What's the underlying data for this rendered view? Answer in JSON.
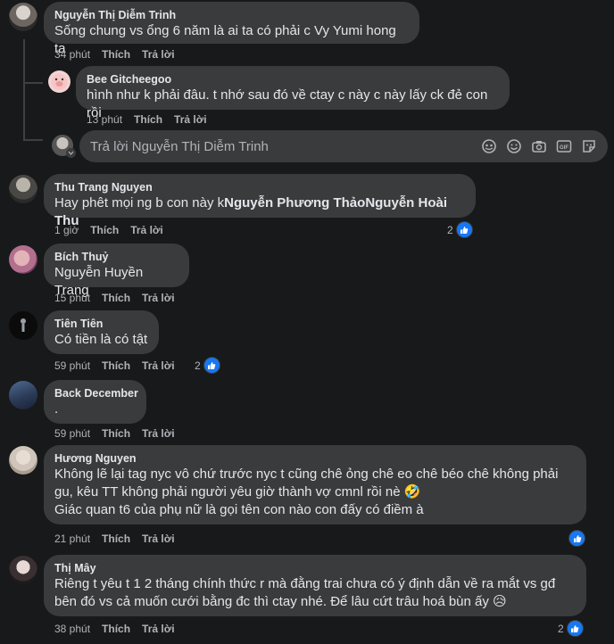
{
  "comments": [
    {
      "name": "Nguyễn Thị Diễm Trinh",
      "text": "Sống chung vs ổng 6 năm là ai ta có phải c Vy Yumi hong ta",
      "time": "34 phút",
      "like": "Thích",
      "reply": "Trả lời"
    },
    {
      "name": "Bee Gitcheegoo",
      "text": "hình như k phải đâu. t nhớ sau đó về ctay c này c này lấy ck đẻ con rồi",
      "time": "13 phút",
      "like": "Thích",
      "reply": "Trả lời"
    },
    {
      "name": "Thu Trang Nguyen",
      "text_prefix": "Hay phêt mọi ng b con này k",
      "mention1": "Nguyễn Phương Thảo",
      "mention2": "Nguyễn Hoài Thu",
      "time": "1 giờ",
      "like": "Thích",
      "reply": "Trả lời",
      "reactions": "2"
    },
    {
      "name": "Bích Thuỷ",
      "text": "Nguyễn Huyền Trang",
      "time": "15 phút",
      "like": "Thích",
      "reply": "Trả lời"
    },
    {
      "name": "Tiên Tiên",
      "text": "Có tiền là có tật",
      "time": "59 phút",
      "like": "Thích",
      "reply": "Trả lời",
      "reactions": "2"
    },
    {
      "name": "Back December",
      "text": ".",
      "time": "59 phút",
      "like": "Thích",
      "reply": "Trả lời"
    },
    {
      "name": "Hương Nguyen",
      "line1": "Không lẽ lại tag nyc vô chứ trước nyc t cũng chê ỏng chê eo chê béo chê không phải",
      "line2": "gu, kêu TT không phải người yêu giờ thành vợ cmnl rồi nè 🤣",
      "line3": "Giác quan t6 của phụ nữ là gọi tên con nào con đấy có điềm à",
      "time": "21 phút",
      "like": "Thích",
      "reply": "Trả lời"
    },
    {
      "name": "Thị Mây",
      "line1": "Riêng t yêu t 1 2 tháng chính thức r mà đằng trai chưa có ý định dẫn về ra mắt vs gđ",
      "line2": "bên đó vs cả muốn cưới bằng đc thì ctay nhé. Để lâu cứt trâu hoá bùn ấy 😥",
      "time": "38 phút",
      "like": "Thích",
      "reply": "Trả lời",
      "reactions": "2"
    }
  ],
  "reply_box": {
    "placeholder": "Trả lời Nguyễn Thị Diễm Trinh"
  },
  "icons": [
    "avatar-sticker-icon",
    "emoji-icon",
    "camera-icon",
    "gif-icon",
    "sticker-icon",
    "like-reaction-icon"
  ],
  "colors": {
    "background": "#18191a",
    "bubble": "#3a3b3c",
    "text": "#e4e6eb",
    "muted": "#b0b3b8",
    "like_blue": "#1877f2"
  }
}
